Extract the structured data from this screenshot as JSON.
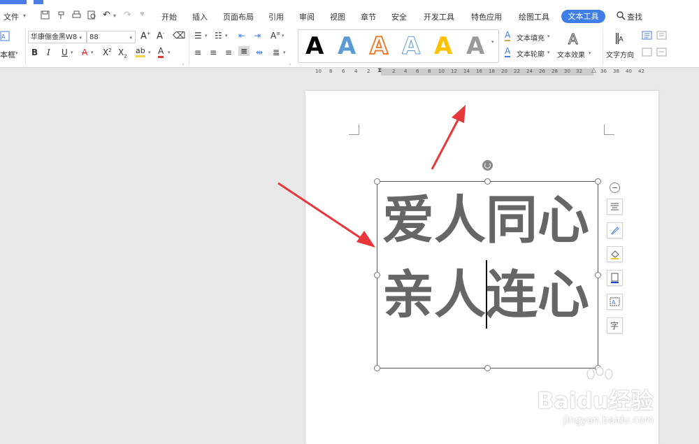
{
  "menu": {
    "file": "文件",
    "tabs": [
      "开始",
      "插入",
      "页面布局",
      "引用",
      "审阅",
      "视图",
      "章节",
      "安全",
      "开发工具",
      "特色应用",
      "绘图工具"
    ],
    "active_tab": "文本工具",
    "search": "查找"
  },
  "ribbon": {
    "left_labels": [
      "本框"
    ],
    "font_name": "华康俪金黑W8",
    "font_size": "88",
    "text_fill": "文本填充",
    "text_outline": "文本轮廓",
    "text_effect": "文本效果",
    "text_direction": "文字方向",
    "gallery_letter": "A"
  },
  "ruler": {
    "left_ticks": [
      "10",
      "8",
      "6",
      "4",
      "2"
    ],
    "right_ticks": [
      "2",
      "4",
      "6",
      "8",
      "10",
      "12",
      "14",
      "16",
      "18",
      "20",
      "22",
      "24",
      "26",
      "28",
      "30",
      "32",
      "36",
      "38",
      "40",
      "42"
    ]
  },
  "textbox": {
    "line1": "爱人同心",
    "line2_before": "亲人",
    "line2_after": "连心"
  },
  "watermark": {
    "brand": "Baidu经验",
    "url": "jingyan.baidu.com"
  },
  "colors": {
    "accent": "#3e7ee6",
    "text_gray": "#666666",
    "arrow": "#e8373a"
  }
}
